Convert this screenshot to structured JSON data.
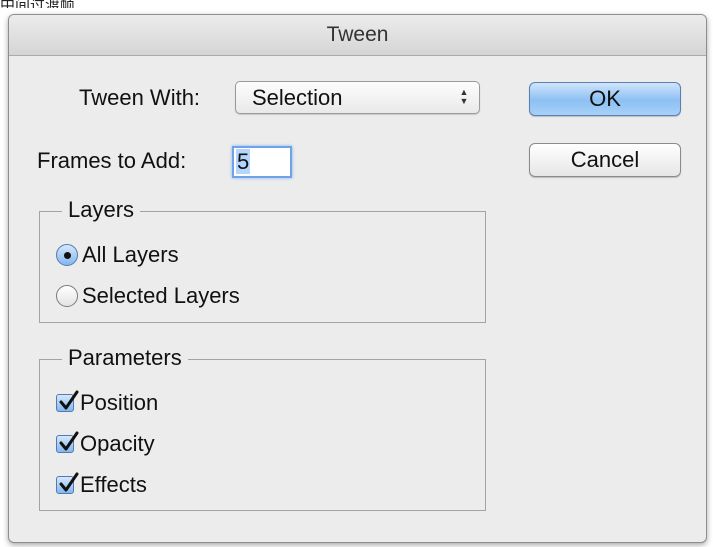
{
  "page_top_text": "中间过渡帧",
  "dialog": {
    "title": "Tween",
    "tween_with_label": "Tween With:",
    "tween_with_value": "Selection",
    "frames_label": "Frames to Add:",
    "frames_value": "5",
    "ok_label": "OK",
    "cancel_label": "Cancel",
    "layers": {
      "title": "Layers",
      "options": [
        {
          "label": "All Layers",
          "selected": true
        },
        {
          "label": "Selected Layers",
          "selected": false
        }
      ]
    },
    "parameters": {
      "title": "Parameters",
      "items": [
        {
          "label": "Position",
          "checked": true
        },
        {
          "label": "Opacity",
          "checked": true
        },
        {
          "label": "Effects",
          "checked": true
        }
      ]
    }
  },
  "colors": {
    "dialog_bg": "#ececec",
    "accent_blue": "#8cc0f3",
    "check_blue": "#84b6ee"
  }
}
